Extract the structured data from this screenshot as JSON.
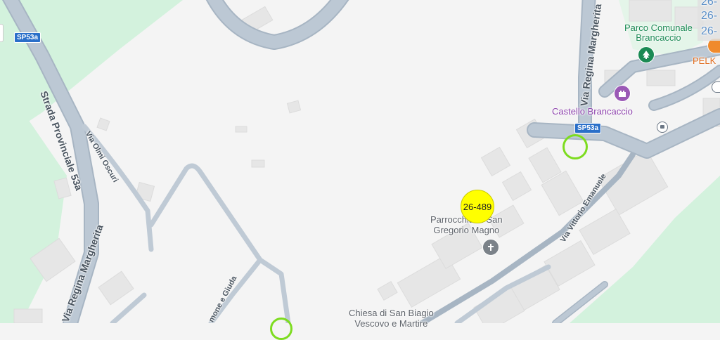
{
  "roads": {
    "strada_provinciale": "Strada Provinciale 53a",
    "via_olmi_oscuri": "Via Olmi Oscuri",
    "via_regina_margherita_bottom": "Via Regina Margherita",
    "via_regina_margherita_top": "Via Regina Margherita",
    "via_vittorio_emanuele": "Via Vittorio Emanuele",
    "via_simone_e_giuda": "mone e Giuda"
  },
  "shields": {
    "left": "SP53a",
    "right": "SP53a"
  },
  "pois": {
    "parco_line1": "Parco Comunale",
    "parco_line2": "Brancaccio",
    "castello": "Castello Brancaccio",
    "parrocchia_line1": "Parrocchia di San",
    "parrocchia_line2": "Gregorio Magno",
    "chiesa_line1": "Chiesa di San Biagio",
    "chiesa_line2": "Vescovo e Martire",
    "pelk": "PELK"
  },
  "markers": {
    "yellow_label": "26-489"
  },
  "cluster_labels": [
    "26-",
    "26-",
    "26-"
  ],
  "icons": {
    "tree": "tree-icon",
    "castle": "castle-icon",
    "church": "church-cross-icon",
    "bus": "bus-stop-icon",
    "food": "restaurant-icon"
  },
  "colors": {
    "background": "#f4f4f4",
    "park": "#d3f2dd",
    "road_fill": "#b9c6d2",
    "marker_yellow": "#ffff00",
    "marker_ring": "#7ddc1f",
    "shield": "#2a6fc9"
  }
}
